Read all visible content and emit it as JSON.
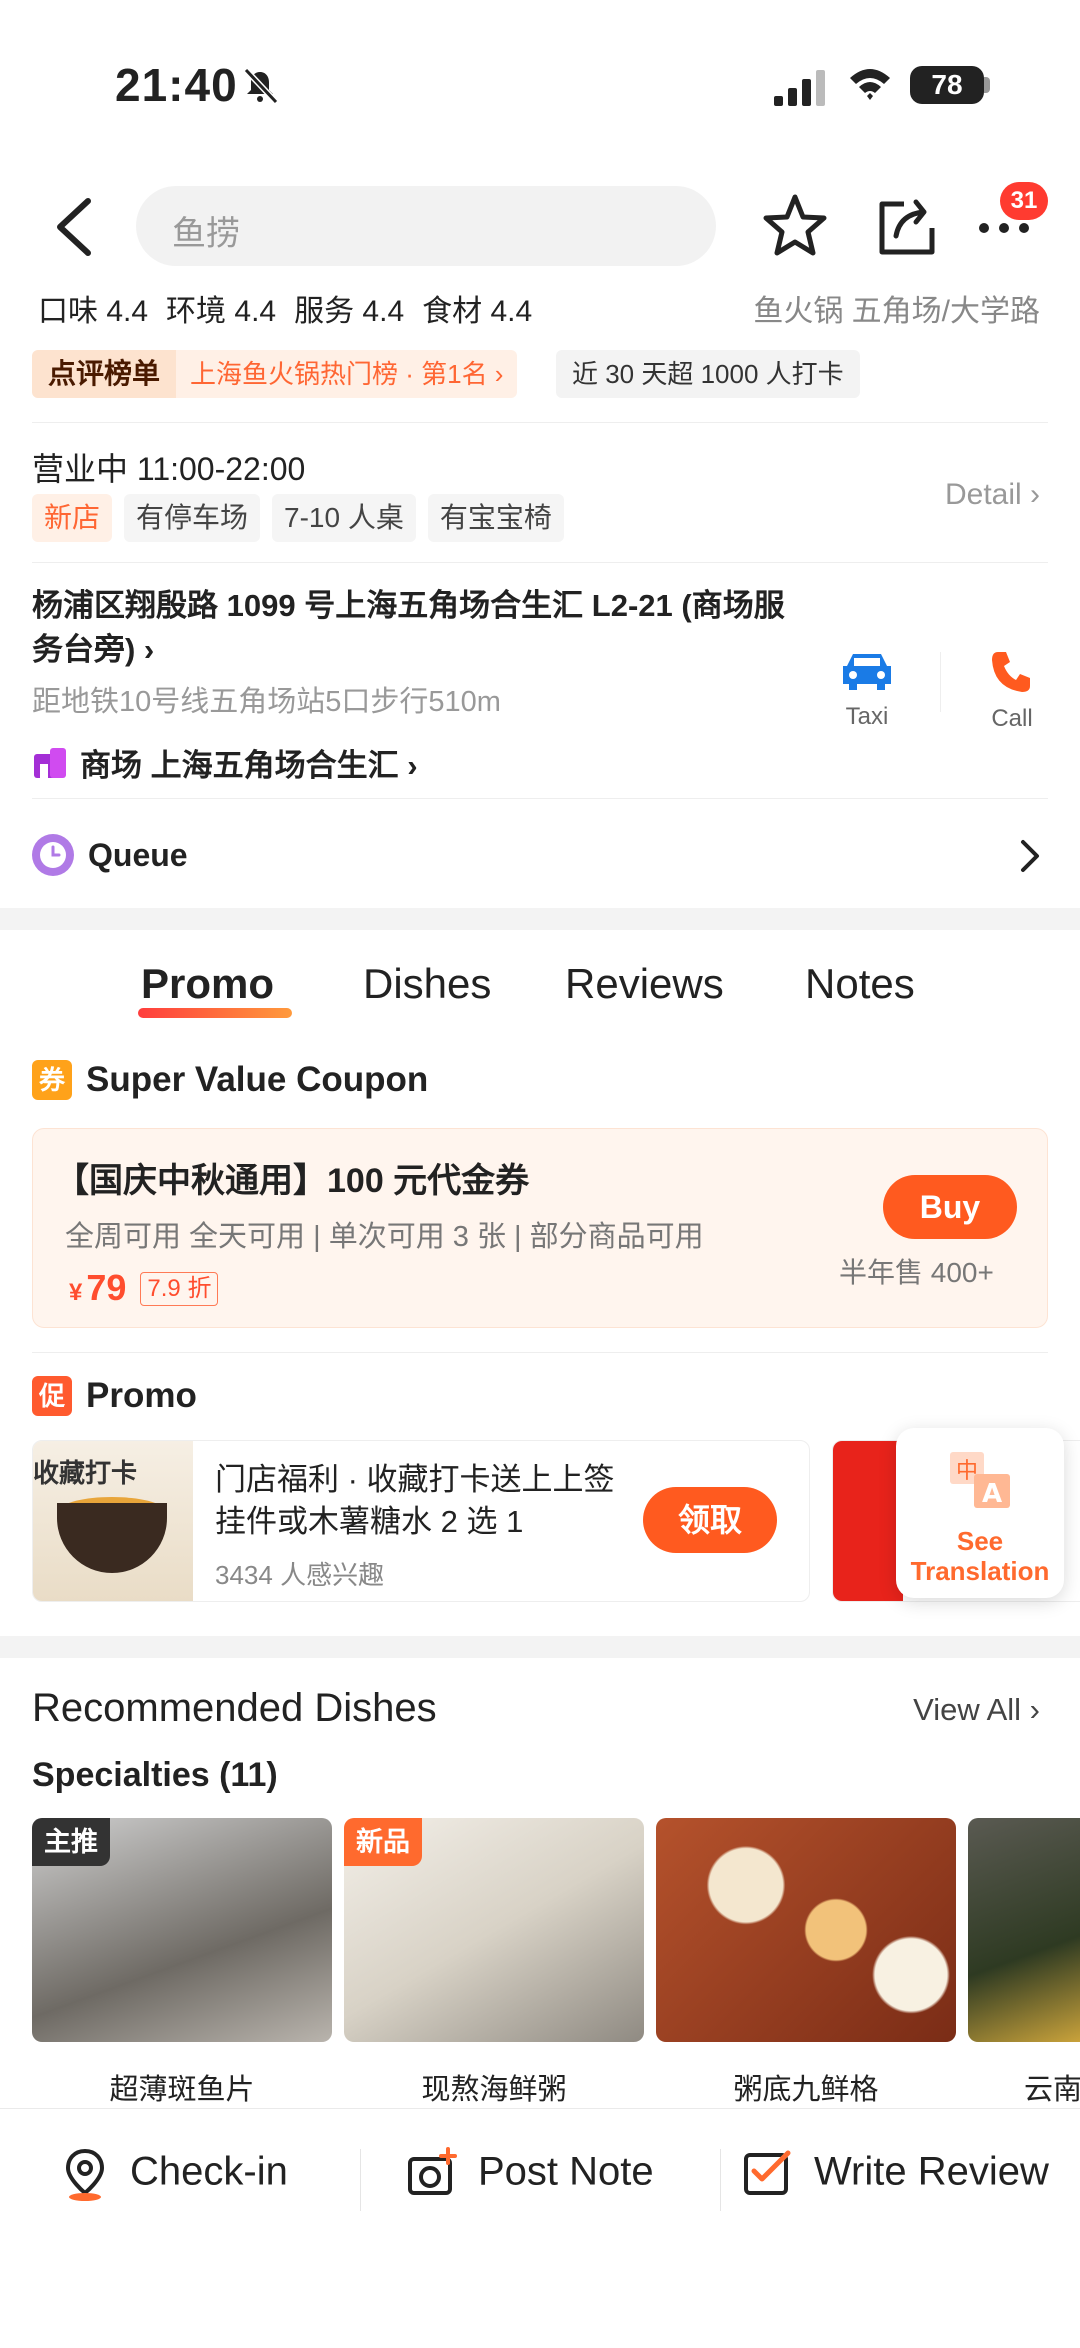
{
  "status_bar": {
    "time": "21:40",
    "battery": "78"
  },
  "nav": {
    "search_placeholder": "鱼捞",
    "notification_count": "31"
  },
  "ratings": [
    {
      "label": "口味 4.4"
    },
    {
      "label": "环境 4.4"
    },
    {
      "label": "服务 4.4"
    },
    {
      "label": "食材 4.4"
    }
  ],
  "category": "鱼火锅  五角场/大学路",
  "rank": {
    "tag": "点评榜单",
    "text": "上海鱼火锅热门榜 · 第1名 ›",
    "checkins": "近 30 天超 1000 人打卡"
  },
  "hours": {
    "label": "营业中  11:00-22:00",
    "detail": "Detail ›"
  },
  "tags": [
    "新店",
    "有停车场",
    "7-10 人桌",
    "有宝宝椅"
  ],
  "address": {
    "line": "杨浦区翔殷路 1099 号上海五角场合生汇 L2-21 (商场服务台旁) ›",
    "metro": "距地铁10号线五角场站5口步行510m",
    "mall": "商场  上海五角场合生汇 ›"
  },
  "actions": {
    "taxi": "Taxi",
    "call": "Call"
  },
  "queue": {
    "label": "Queue"
  },
  "tabs": [
    {
      "label": "Promo"
    },
    {
      "label": "Dishes"
    },
    {
      "label": "Reviews"
    },
    {
      "label": "Notes"
    }
  ],
  "coupon": {
    "section_icon": "券",
    "section_title": "Super Value Coupon",
    "name": "【国庆中秋通用】100 元代金券",
    "rules": "全周可用  全天可用 | 单次可用 3 张 | 部分商品可用",
    "currency": "¥",
    "price": "79",
    "discount": "7.9 折",
    "buy": "Buy",
    "sold": "半年售 400+"
  },
  "promo": {
    "section_icon": "促",
    "section_title": "Promo",
    "image_text": "收藏打卡",
    "desc": "门店福利 · 收藏打卡送上上签挂件或木薯糖水 2 选 1",
    "interest": "3434 人感兴趣",
    "claim": "领取",
    "translate": "See Translation"
  },
  "recommended": {
    "title": "Recommended Dishes",
    "view_all": "View All ›",
    "specialties": "Specialties (11)",
    "dishes": [
      {
        "name": "超薄斑鱼片",
        "tag": "主推"
      },
      {
        "name": "现熬海鲜粥",
        "tag": "新品"
      },
      {
        "name": "粥底九鲜格",
        "tag": ""
      },
      {
        "name": "云南",
        "tag": ""
      }
    ]
  },
  "bottom_bar": {
    "checkin": "Check-in",
    "post_note": "Post Note",
    "write_review": "Write Review"
  },
  "colors": {
    "accent": "#ff5a1f",
    "price": "#ff4d2e",
    "taxi": "#1a7be6",
    "call": "#ff5a1f"
  }
}
